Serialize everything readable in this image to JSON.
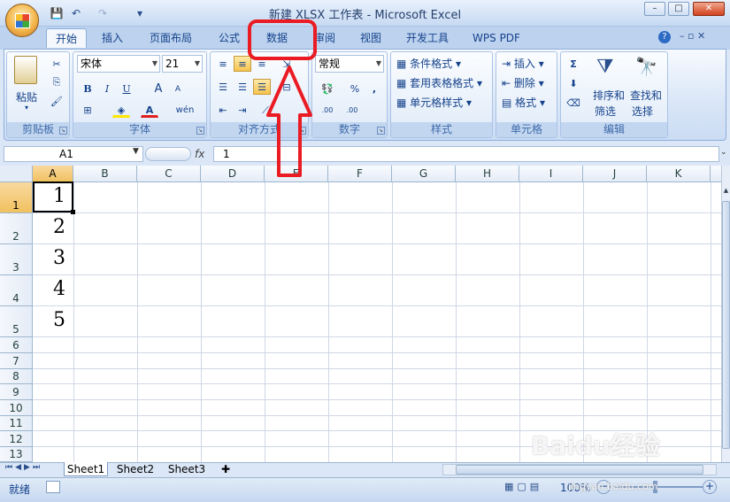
{
  "window": {
    "title": "新建 XLSX 工作表 - Microsoft Excel",
    "minimize": "–",
    "maximize": "□",
    "close": "✕"
  },
  "qat": {
    "save": "💾",
    "undo": "↶",
    "redo": "↷",
    "more": "▾"
  },
  "tabs": [
    "开始",
    "插入",
    "页面布局",
    "公式",
    "数据",
    "审阅",
    "视图",
    "开发工具",
    "WPS PDF"
  ],
  "ribbon": {
    "clipboard": {
      "label": "剪贴板",
      "paste": "粘贴"
    },
    "font": {
      "label": "字体",
      "name": "宋体",
      "size": "21",
      "bold": "B",
      "italic": "I",
      "underline": "U",
      "grow": "A",
      "shrink": "A",
      "wen": "wén"
    },
    "alignment": {
      "label": "对齐方式"
    },
    "number": {
      "label": "数字",
      "format": "常规",
      "percent": "%",
      "comma": ",",
      "inc": ".00",
      "dec": ".00"
    },
    "styles": {
      "label": "样式",
      "conditional": "条件格式",
      "table": "套用表格格式",
      "cell": "单元格样式"
    },
    "cells": {
      "label": "单元格",
      "insert": "插入",
      "delete": "删除",
      "format": "格式"
    },
    "editing": {
      "label": "编辑",
      "sigma": "Σ",
      "sort": "排序和",
      "sort2": "筛选",
      "find": "查找和",
      "find2": "选择"
    }
  },
  "formula": {
    "namebox": "A1",
    "fx": "fx",
    "content": "1"
  },
  "grid": {
    "columns": [
      "A",
      "B",
      "C",
      "D",
      "E",
      "F",
      "G",
      "H",
      "I",
      "J",
      "K"
    ],
    "rows": [
      "1",
      "2",
      "3",
      "4",
      "5",
      "6",
      "7",
      "8",
      "9",
      "10",
      "11",
      "12",
      "13"
    ],
    "values": [
      "1",
      "2",
      "3",
      "4",
      "5"
    ]
  },
  "sheets": [
    "Sheet1",
    "Sheet2",
    "Sheet3"
  ],
  "status": {
    "ready": "就绪",
    "zoom": "100%"
  },
  "watermark": {
    "text": "Baidu经验",
    "url": "jingyan.baidu.com"
  },
  "colors": {
    "accent": "#15428b",
    "annotation": "#ea1b23",
    "ribbon": "#dbe7f7"
  }
}
